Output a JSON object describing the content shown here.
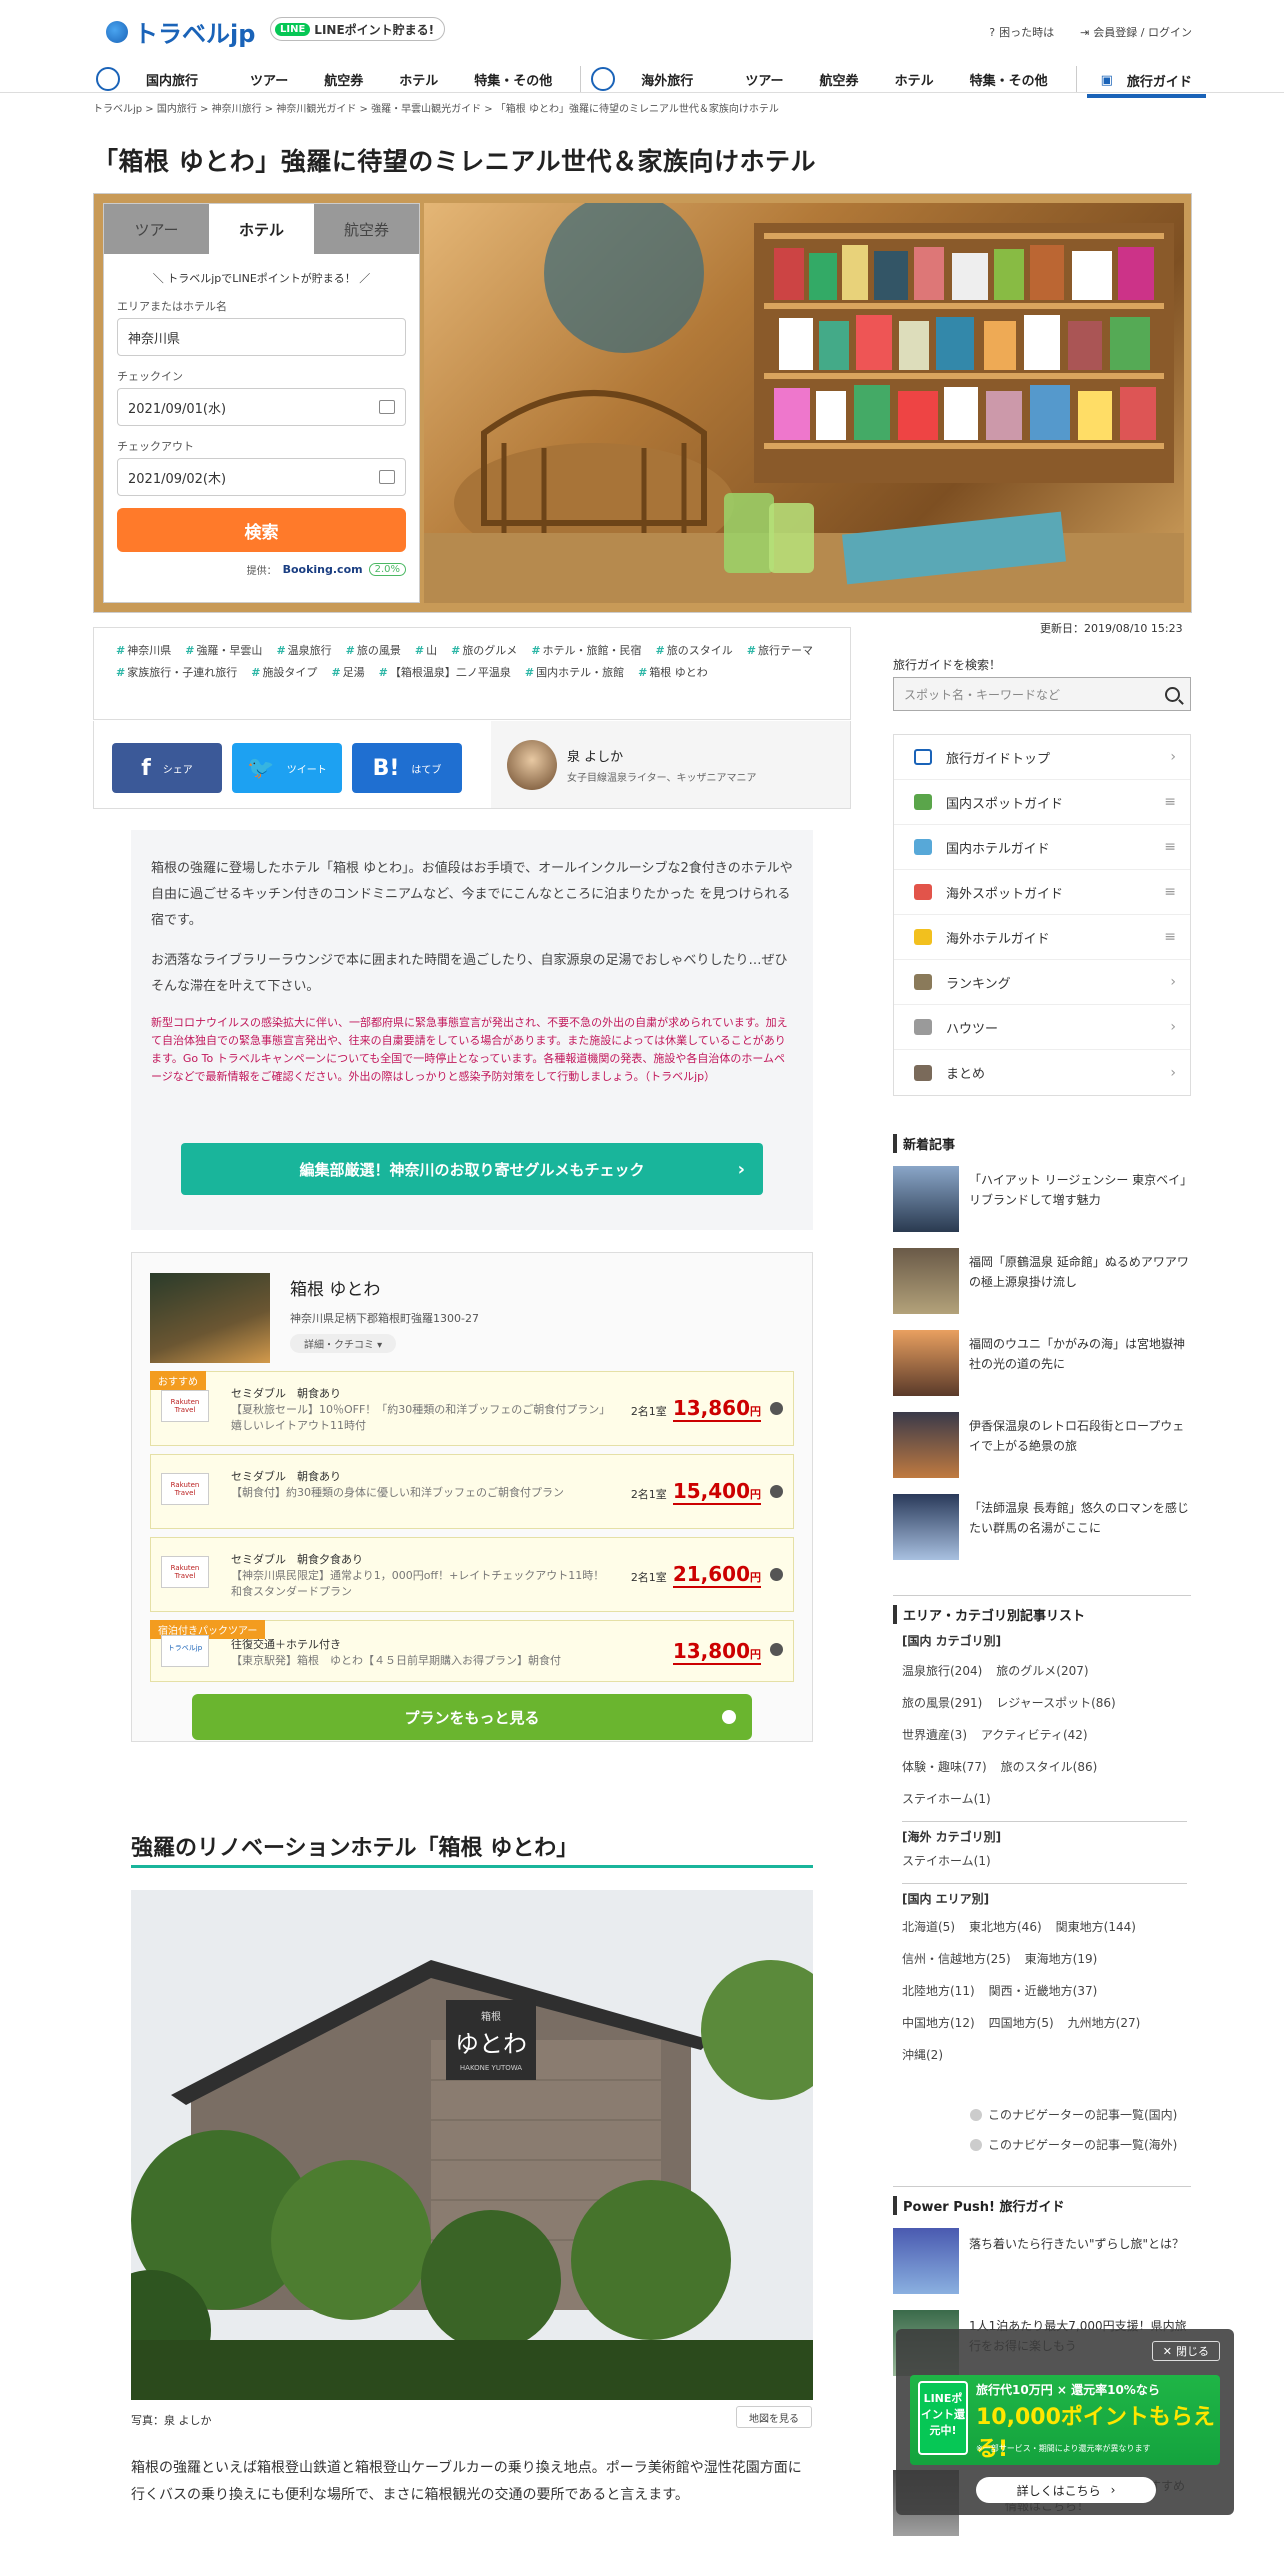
{
  "header": {
    "logo": "トラベルjp",
    "line_badge": "LINEポイント貯まる!",
    "line_icon": "LINE",
    "help": "困った時は",
    "login": "会員登録 / ログイン",
    "nav_domestic": [
      "国内旅行",
      "ツアー",
      "航空券",
      "ホテル",
      "特集・その他"
    ],
    "nav_overseas": [
      "海外旅行",
      "ツアー",
      "航空券",
      "ホテル",
      "特集・その他"
    ],
    "nav_guide": "旅行ガイド"
  },
  "breadcrumb": "トラベルjp  >  国内旅行  >  神奈川旅行  >  神奈川観光ガイド  >  強羅・早雲山観光ガイド  >  「箱根 ゆとわ」強羅に待望のミレニアル世代＆家族向けホテル",
  "title": "「箱根 ゆとわ」強羅に待望のミレニアル世代＆家族向けホテル",
  "search": {
    "tabs": [
      "ツアー",
      "ホテル",
      "航空券"
    ],
    "promo": "＼ トラベルjpでLINEポイントが貯まる！ ／",
    "area_label": "エリアまたはホテル名",
    "area_value": "神奈川県",
    "checkin_label": "チェックイン",
    "checkin_value": "2021/09/01(水)",
    "checkout_label": "チェックアウト",
    "checkout_value": "2021/09/02(木)",
    "button": "検索",
    "provided": "提供：",
    "provider": "Booking.com",
    "rate": "2.0%"
  },
  "updated": "更新日：2019/08/10 15:23",
  "tags": [
    "神奈川県",
    "強羅・早雲山",
    "温泉旅行",
    "旅の風景",
    "山",
    "旅のグルメ",
    "ホテル・旅館・民宿",
    "旅のスタイル",
    "旅行テーマ",
    "家族旅行・子連れ旅行",
    "施設タイプ",
    "足湯",
    "【箱根温泉】二ノ平温泉",
    "国内ホテル・旅館",
    "箱根 ゆとわ"
  ],
  "share": {
    "facebook": "シェア",
    "twitter": "ツイート",
    "hatena": "はてブ"
  },
  "author": {
    "name": "泉 よしか",
    "desc": "女子目線温泉ライター、キッザニアマニア"
  },
  "intro": {
    "p1": "箱根の強羅に登場したホテル「箱根 ゆとわ」。お値段はお手頃で、オールインクルーシブな2食付きのホテルや自由に過ごせるキッチン付きのコンドミニアムなど、今までにこんなところに泊まりたかった を見つけられる宿です。",
    "p2": "お洒落なライブラリーラウンジで本に囲まれた時間を過ごしたり、自家源泉の足湯でおしゃべりしたり…ぜひそんな滞在を叶えて下さい。",
    "notice": "新型コロナウイルスの感染拡大に伴い、一部都府県に緊急事態宣言が発出され、不要不急の外出の自粛が求められています。加えて自治体独自での緊急事態宣言発出や、往来の自粛要請をしている場合があります。また施設によっては休業していることがあります。Go To トラベルキャンペーンについても全国で一時停止となっています。各種報道機関の発表、施設や各自治体のホームページなどで最新情報をご確認ください。外出の際はしっかりと感染予防対策をして行動しましょう。（トラベルjp）",
    "button": "編集部厳選！神奈川のお取り寄せグルメもチェック"
  },
  "hotel": {
    "name": "箱根 ゆとわ",
    "address": "神奈川県足柄下郡箱根町強羅1300-27",
    "detail": "詳細・クチコミ ▾",
    "plans": [
      {
        "ribbon": "おすすめ",
        "provider": "Rakuten Travel",
        "name": "セミダブル　朝食あり",
        "desc": "【夏秋旅セール】10％OFF！「約30種類の和洋ブッフェのご朝食付プラン」嬉しいレイトアウト11時付",
        "guests": "2名1室",
        "price": "13,860",
        "unit": "円"
      },
      {
        "ribbon": "",
        "provider": "Rakuten Travel",
        "name": "セミダブル　朝食あり",
        "desc": "【朝食付】約30種類の身体に優しい和洋ブッフェのご朝食付プラン",
        "guests": "2名1室",
        "price": "15,400",
        "unit": "円"
      },
      {
        "ribbon": "",
        "provider": "Rakuten Travel",
        "name": "セミダブル　朝食夕食あり",
        "desc": "【神奈川県民限定】通常より1，000円off！+レイトチェックアウト11時！和食スタンダードプラン",
        "guests": "2名1室",
        "price": "21,600",
        "unit": "円"
      },
      {
        "ribbon": "宿泊付きパックツアー",
        "provider": "トラベルjp",
        "name": "往復交通＋ホテル付き",
        "desc": "【東京駅発】箱根　ゆとわ【４５日前早期購入お得プラン】朝食付",
        "guests": "",
        "price": "13,800",
        "unit": "円"
      }
    ],
    "more": "プランをもっと見る"
  },
  "section": {
    "heading": "強羅のリノベーションホテル「箱根 ゆとわ」",
    "sign_small": "箱根",
    "sign_big": "ゆとわ",
    "sign_en": "HAKONE YUTOWA",
    "caption": "写真：泉 よしか",
    "map": "地図を見る",
    "body": "箱根の強羅といえば箱根登山鉄道と箱根登山ケーブルカーの乗り換え地点。ポーラ美術館や湿性花園方面に行くバスの乗り換えにも便利な場所で、まさに箱根観光の交通の要所であると言えます。"
  },
  "sidebar": {
    "search_title": "旅行ガイドを検索！",
    "search_placeholder": "スポット名・キーワードなど",
    "menu": [
      "旅行ガイドトップ",
      "国内スポットガイド",
      "国内ホテルガイド",
      "海外スポットガイド",
      "海外ホテルガイド",
      "ランキング",
      "ハウツー",
      "まとめ"
    ],
    "news_title": "新着記事",
    "news": [
      "「ハイアット リージェンシー 東京ベイ」リブランドして増す魅力",
      "福岡「原鶴温泉 延命館」ぬるめアワアワの極上源泉掛け流し",
      "福岡のウユニ「かがみの海」は宮地嶽神社の光の道の先に",
      "伊香保温泉のレトロ石段街とロープウェイで上がる絶景の旅",
      "「法師温泉 長寿館」悠久のロマンを感じたい群馬の名湯がここに"
    ],
    "cat_title": "エリア・カテゴリ別記事リスト",
    "cat_dom_head": "[国内 カテゴリ別]",
    "cat_dom": [
      [
        "温泉旅行(204)",
        "旅のグルメ(207)"
      ],
      [
        "旅の風景(291)",
        "レジャースポット(86)"
      ],
      [
        "世界遺産(3)",
        "アクティビティ(42)"
      ],
      [
        "体験・趣味(77)",
        "旅のスタイル(86)"
      ],
      [
        "ステイホーム(1)"
      ]
    ],
    "cat_ovs_head": "[海外 カテゴリ別]",
    "cat_ovs": [
      [
        "ステイホーム(1)"
      ]
    ],
    "cat_area_head": "[国内 エリア別]",
    "cat_area": [
      [
        "北海道(5)",
        "東北地方(46)",
        "関東地方(144)"
      ],
      [
        "信州・信越地方(25)",
        "東海地方(19)"
      ],
      [
        "北陸地方(11)",
        "関西・近畿地方(37)"
      ],
      [
        "中国地方(12)",
        "四国地方(5)",
        "九州地方(27)"
      ],
      [
        "沖縄(2)"
      ]
    ],
    "nav_dom": "このナビゲーターの記事一覧(国内)",
    "nav_ovs": "このナビゲーターの記事一覧(海外)",
    "pp_title": "Power Push! 旅行ガイド",
    "pp": [
      "落ち着いたら行きたい\"ずらし旅\"とは？",
      "1人1泊あたり最大7,000円支援！県内旅行をお得に楽しもう",
      "ホテルに泊まるなら今！おすすめ情報はこちら！"
    ]
  },
  "floating": {
    "close": "閉じる",
    "line": "LINEポイント還元中!",
    "headline": "旅行代10万円 × 還元率10%なら",
    "amount": "10,000ポイントもらえる!",
    "note": "※一部サービス・期間により還元率が異なります",
    "more": "詳しくはこちら"
  }
}
